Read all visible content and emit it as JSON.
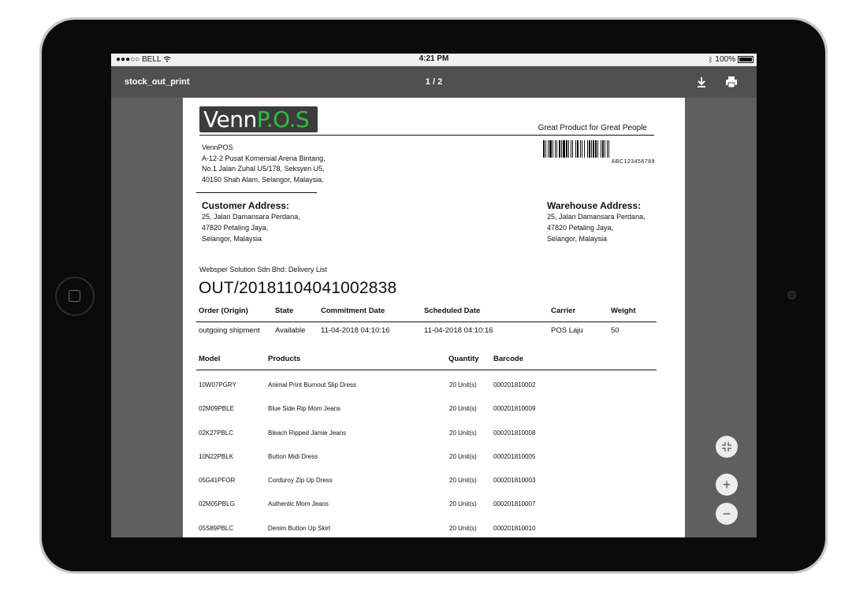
{
  "status_bar": {
    "carrier": "●●●○○ BELL",
    "time": "4:21 PM",
    "battery": "100%"
  },
  "toolbar": {
    "title": "stock_out_print",
    "page_indicator": "1 / 2"
  },
  "document": {
    "logo": {
      "part1": "Venn",
      "part2": "P.O.S"
    },
    "tagline": "Great Product for Great People",
    "barcode_text": "ABC123456789",
    "company": {
      "name": "VennPOS",
      "address_line1": "A-12-2 Pusat Komersial Arena Bintang,",
      "address_line2": "No.1 Jalan Zuhal U5/178, Seksyen U5,",
      "address_line3": "40150 Shah Alam, Selangor, Malaysia."
    },
    "customer_address": {
      "heading": "Customer Address:",
      "line1": "25, Jalan Damansara Perdana,",
      "line2": "47820 Petaling Jaya,",
      "line3": "Selangor, Malaysia"
    },
    "warehouse_address": {
      "heading": "Warehouse Address:",
      "line1": "25, Jalan Damansara Perdana,",
      "line2": "47820 Petaling Jaya,",
      "line3": "Selangor, Malaysia"
    },
    "delivery_list_label": "Websper Solution Sdn Bhd: Delivery List",
    "delivery_number": "OUT/20181104041002838",
    "order_table": {
      "headers": [
        "Order (Origin)",
        "State",
        "Commitment Date",
        "Scheduled Date",
        "Carrier",
        "Weight"
      ],
      "row": [
        "outgoing shipment",
        "Available",
        "11-04-2018 04:10:16",
        "11-04-2018 04:10:16",
        "POS Laju",
        "50"
      ]
    },
    "product_table": {
      "headers": [
        "Model",
        "Products",
        "Quantity",
        "Barcode"
      ],
      "rows": [
        [
          "10W07PGRY",
          "Animal Print Burnout Slip Dress",
          "20 Unit(s)",
          "000201810002"
        ],
        [
          "02M09PBLE",
          "Blue Side Rip Mom Jeans",
          "20 Unit(s)",
          "000201810009"
        ],
        [
          "02K27PBLC",
          "Bleach Ripped Jamie Jeans",
          "20 Unit(s)",
          "000201810008"
        ],
        [
          "10N22PBLK",
          "Button Midi Dress",
          "20 Unit(s)",
          "000201810005"
        ],
        [
          "05G41PFOR",
          "Corduroy Zip Up Dress",
          "20 Unit(s)",
          "000201810003"
        ],
        [
          "02M05PBLG",
          "Authentic Mom Jeans",
          "20 Unit(s)",
          "000201810007"
        ],
        [
          "05S89PBLC",
          "Denim Button Up Skirt",
          "20 Unit(s)",
          "000201810010"
        ]
      ]
    }
  },
  "icons": {
    "download": "download-icon",
    "print": "printer-icon",
    "fit": "fit-page-icon",
    "zoom_in": "zoom-in-icon",
    "zoom_out": "zoom-out-icon"
  },
  "colors": {
    "toolbar": "#505050",
    "viewer": "#5f5f5f",
    "logo_bg": "#3c3c3c",
    "logo_green": "#2fbf3f"
  }
}
